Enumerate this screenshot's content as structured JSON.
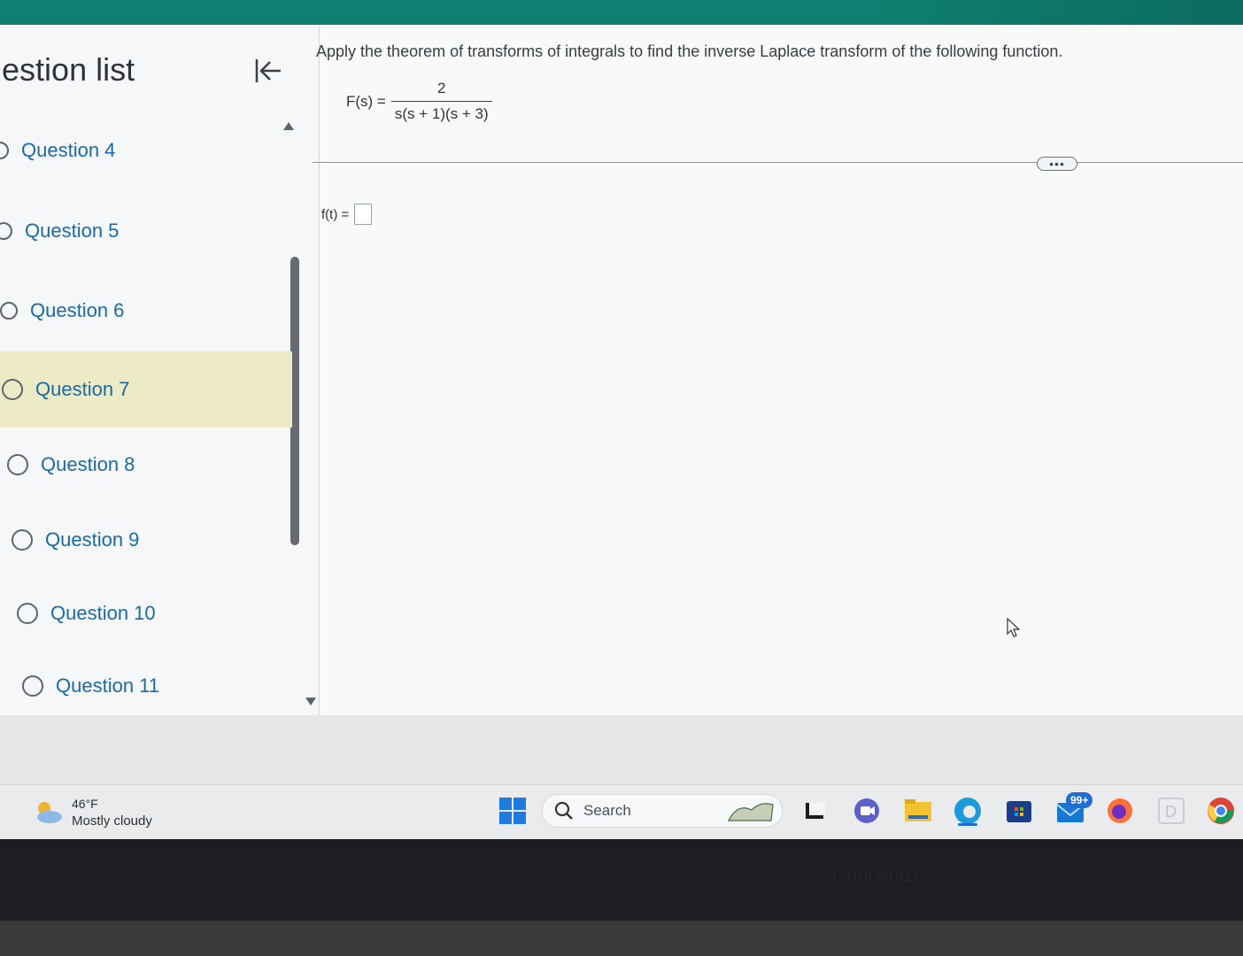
{
  "sidebar": {
    "title": "uestion list",
    "items": [
      {
        "label": "Question 4",
        "selected": false
      },
      {
        "label": "Question 5",
        "selected": false
      },
      {
        "label": "Question 6",
        "selected": false
      },
      {
        "label": "Question 7",
        "selected": true
      },
      {
        "label": "Question 8",
        "selected": false
      },
      {
        "label": "Question 9",
        "selected": false
      },
      {
        "label": "Question 10",
        "selected": false
      },
      {
        "label": "Question 11",
        "selected": false
      }
    ]
  },
  "question": {
    "prompt": "Apply the theorem of transforms of integrals to find the inverse Laplace transform of the following function.",
    "function_lhs": "F(s) =",
    "numerator": "2",
    "denominator": "s(s + 1)(s + 3)",
    "answer_label": "f(t) =",
    "answer_value": "",
    "more_button": "•••"
  },
  "taskbar": {
    "weather_temp": "46°F",
    "weather_desc": "Mostly cloudy",
    "search_label": "Search",
    "mail_badge": "99+"
  },
  "bezel": {
    "text": "ConceptD"
  },
  "colors": {
    "accent": "#0e7f70",
    "link": "#1b6aa6",
    "selected_bg": "#ecebc5"
  }
}
